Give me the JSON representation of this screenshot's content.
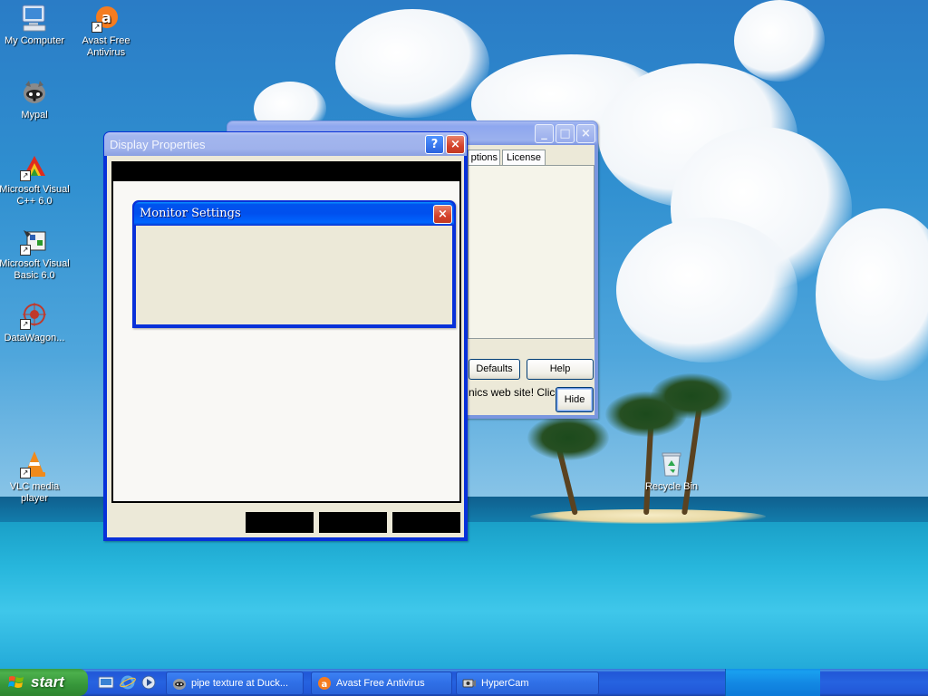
{
  "desktop": {
    "icons": [
      {
        "label": "My Computer"
      },
      {
        "label": "Avast Free Antivirus"
      },
      {
        "label": "Mypal"
      },
      {
        "label": "Microsoft Visual C++ 6.0"
      },
      {
        "label": "Microsoft Visual Basic 6.0"
      },
      {
        "label": "DataWagon..."
      },
      {
        "label": "VLC media player"
      },
      {
        "label": "Recycle Bin"
      }
    ]
  },
  "background_window": {
    "tabs": [
      "ptions",
      "License"
    ],
    "buttons": {
      "defaults": "Defaults",
      "help": "Help",
      "hide": "Hide"
    },
    "message": "nics web site! Click"
  },
  "display_properties": {
    "title": "Display Properties",
    "help_glyph": "?",
    "close_glyph": "×"
  },
  "monitor_settings": {
    "title": "Monitor Settings",
    "close_glyph": "×"
  },
  "taskbar": {
    "start_label": "start",
    "tasks": [
      {
        "label": "pipe texture at Duck..."
      },
      {
        "label": "Avast Free Antivirus"
      },
      {
        "label": "HyperCam"
      }
    ]
  },
  "colors": {
    "xp_blue": "#0054e3",
    "start_green": "#3c9b3c",
    "close_red": "#d4412a",
    "dialog_face": "#ece9d8"
  }
}
